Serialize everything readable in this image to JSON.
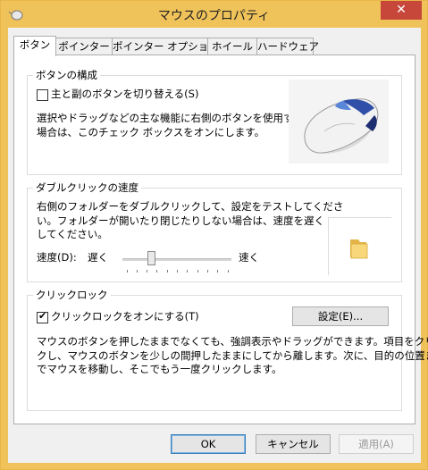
{
  "window": {
    "title": "マウスのプロパティ",
    "close_glyph": "✕"
  },
  "tabs": [
    {
      "label": "ボタン",
      "active": true
    },
    {
      "label": "ポインター",
      "active": false
    },
    {
      "label": "ポインター オプション",
      "active": false
    },
    {
      "label": "ホイール",
      "active": false
    },
    {
      "label": "ハードウェア",
      "active": false
    }
  ],
  "button_config": {
    "title": "ボタンの構成",
    "swap_label": "主と副のボタンを切り替える(S)",
    "swap_checked": false,
    "description_lines": [
      "選択やドラッグなどの主な機能に右側のボタンを使用する",
      "場合は、このチェック ボックスをオンにします。"
    ]
  },
  "double_click": {
    "title": "ダブルクリックの速度",
    "description_lines": [
      "右側のフォルダーをダブルクリックして、設定をテストしてくださ",
      "い。フォルダーが開いたり閉じたりしない場合は、速度を遅く",
      "してください。"
    ],
    "speed_label": "速度(D):",
    "slow_label": "遅く",
    "fast_label": "速く",
    "speed_level": 0.25
  },
  "click_lock": {
    "title": "クリックロック",
    "enable_label": "クリックロックをオンにする(T)",
    "enable_checked": true,
    "settings_button": "設定(E)...",
    "description_lines": [
      "マウスのボタンを押したままでなくても、強調表示やドラッグができます。項目をクリッ",
      "クし、マウスのボタンを少しの間押したままにしてから離します。次に、目的の位置ま",
      "でマウスを移動し、そこでもう一度クリックします。"
    ]
  },
  "footer": {
    "ok": "OK",
    "cancel": "キャンセル",
    "apply": "適用(A)"
  },
  "colors": {
    "frame": "#f0c35a",
    "close": "#c7473b",
    "accent": "#3c7fb1"
  },
  "icons": [
    "mouse-app-icon",
    "mouse-illustration",
    "folder-icon",
    "close-icon"
  ]
}
